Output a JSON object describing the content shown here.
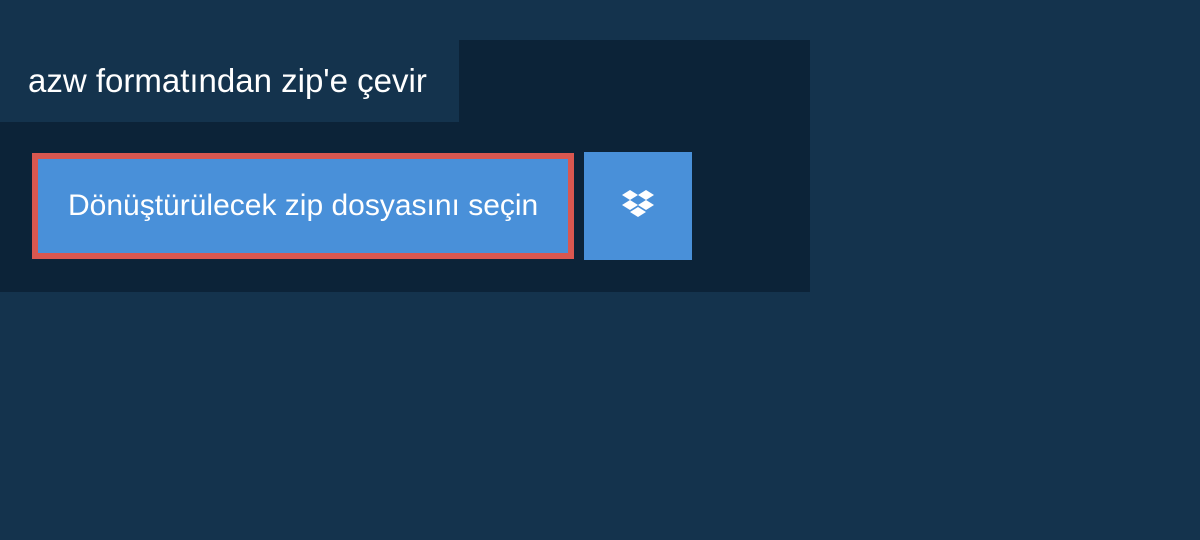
{
  "header": {
    "title": "azw formatından zip'e çevir"
  },
  "actions": {
    "select_file_label": "Dönüştürülecek zip dosyasını seçin"
  },
  "colors": {
    "background_outer": "#14334d",
    "background_panel": "#0c2338",
    "button_blue": "#4990d9",
    "button_border_red": "#d95750",
    "text_white": "#ffffff"
  }
}
